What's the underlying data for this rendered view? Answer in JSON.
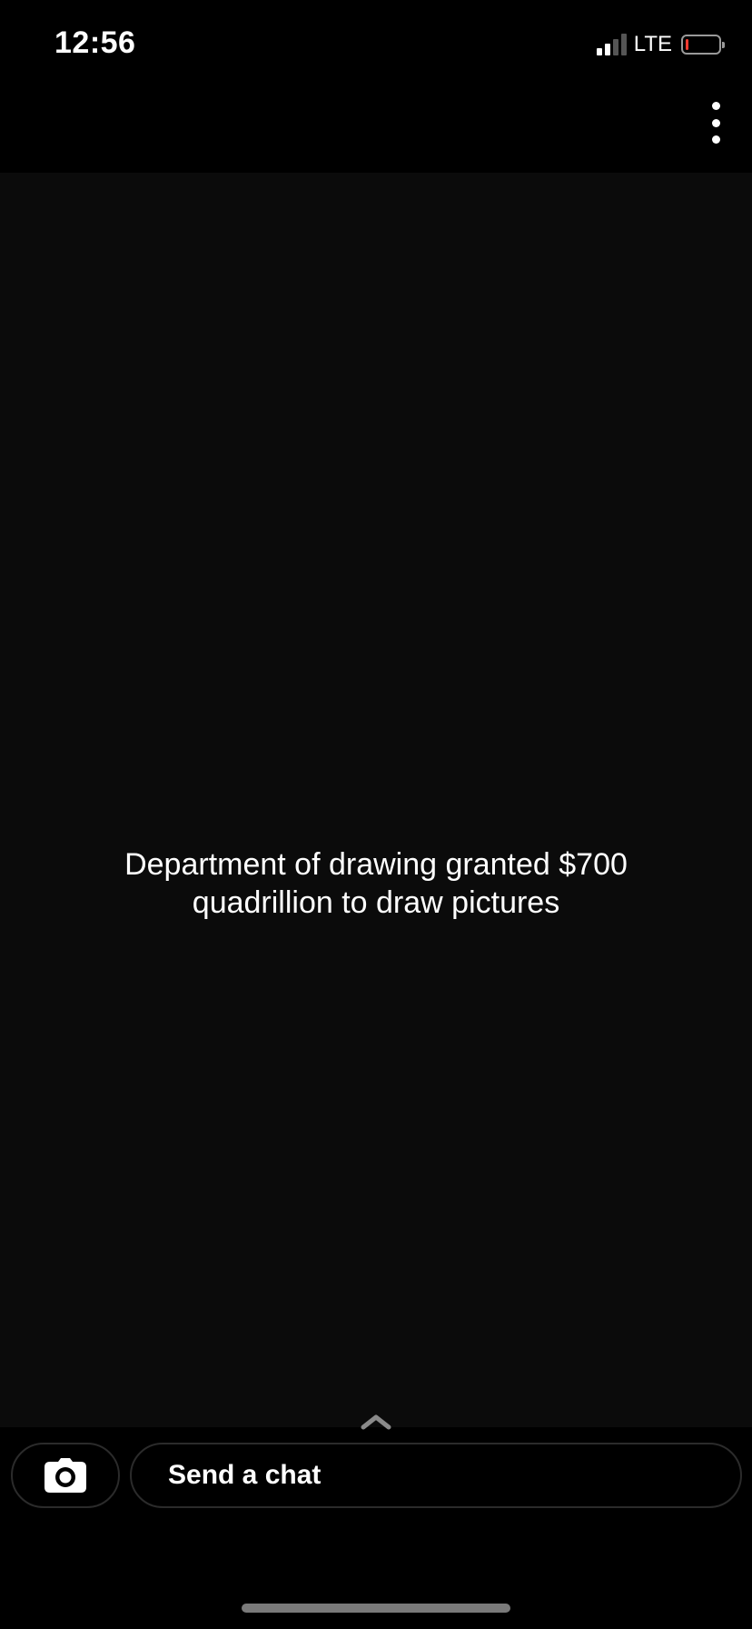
{
  "status_bar": {
    "time": "12:56",
    "network": "LTE",
    "signal_bars_active": 2,
    "signal_bars_total": 4,
    "battery_level": 0.1,
    "battery_color": "#ff3b30"
  },
  "header": {
    "more_icon": "more-vertical-icon"
  },
  "snap": {
    "caption": "Department of drawing granted $700 quadrillion to draw pictures"
  },
  "footer": {
    "swipe_up_icon": "chevron-up-icon",
    "camera_icon": "camera-icon",
    "chat_placeholder": "Send a chat"
  }
}
